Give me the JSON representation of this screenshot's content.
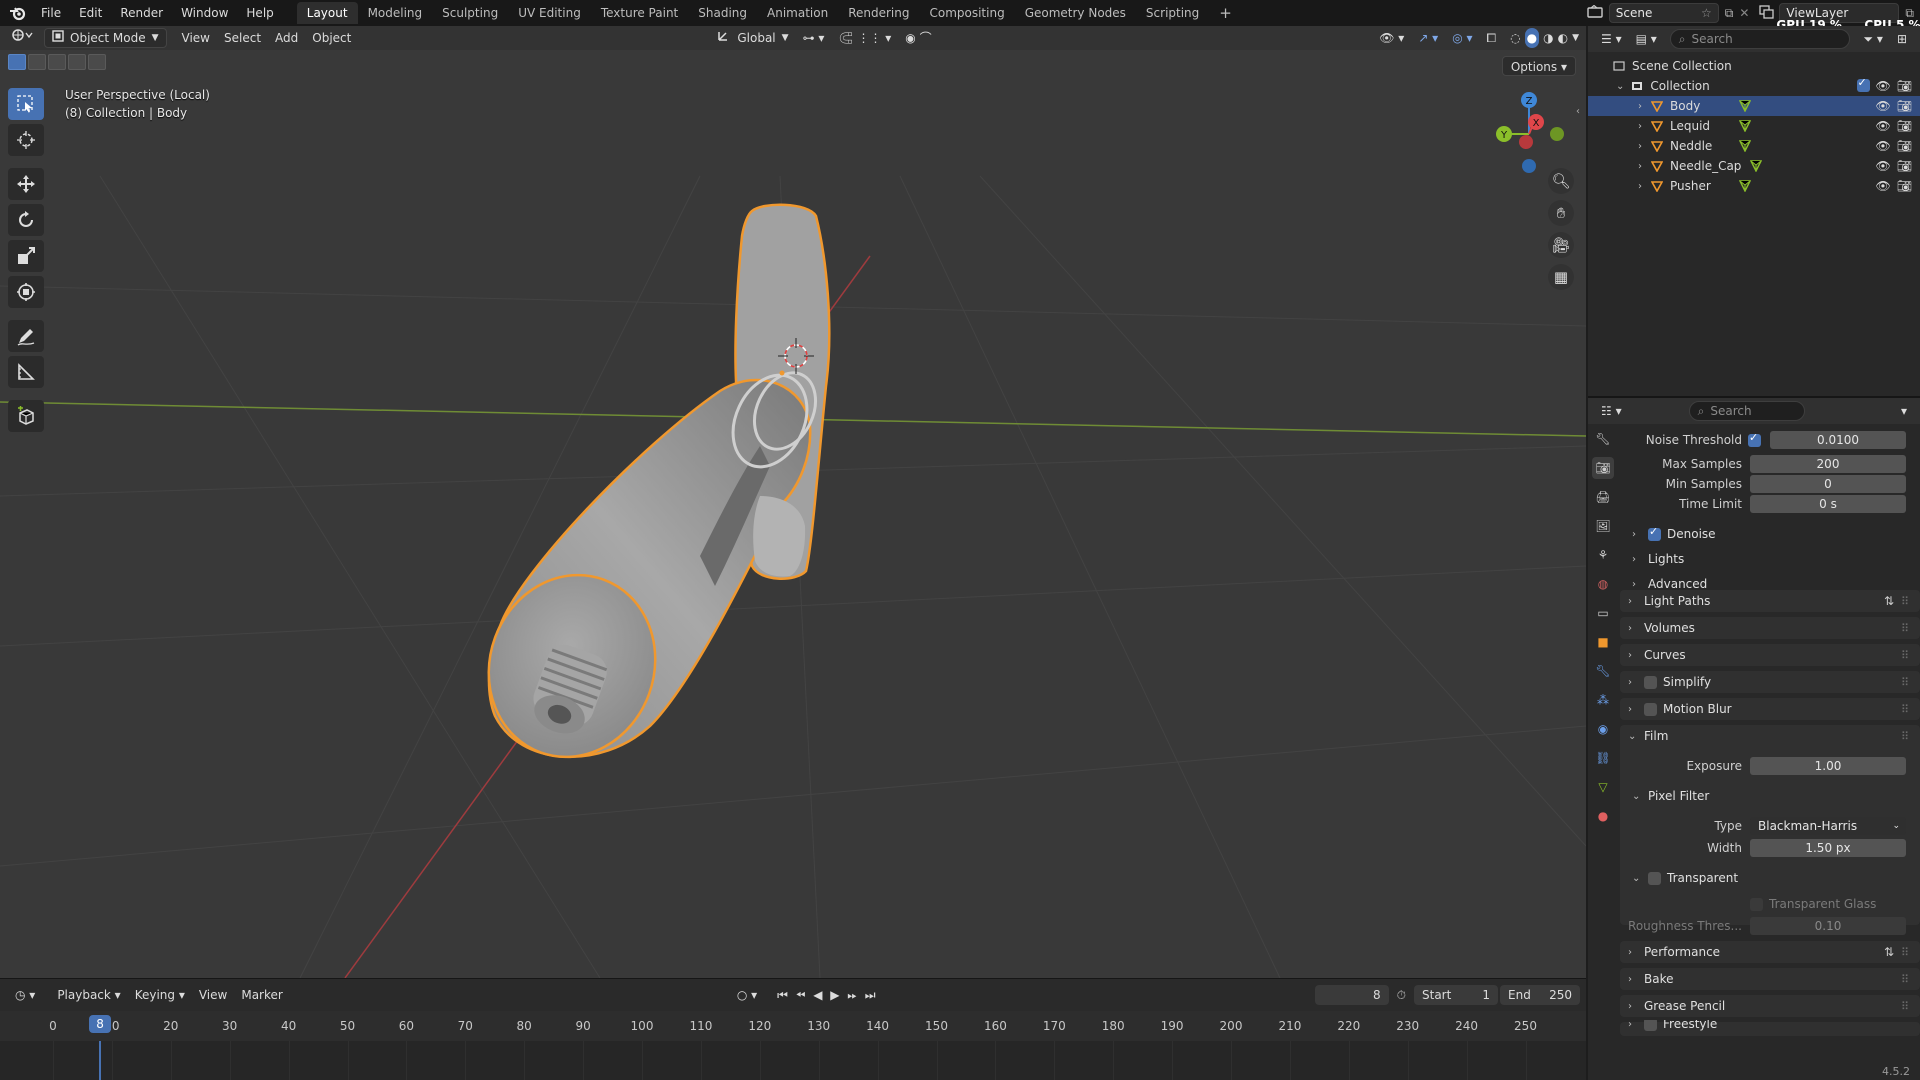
{
  "menubar": {
    "items": [
      "File",
      "Edit",
      "Render",
      "Window",
      "Help"
    ],
    "workspaces": [
      "Layout",
      "Modeling",
      "Sculpting",
      "UV Editing",
      "Texture Paint",
      "Shading",
      "Animation",
      "Rendering",
      "Compositing",
      "Geometry Nodes",
      "Scripting"
    ],
    "active_workspace": "Layout",
    "add_workspace": "+",
    "scene_name": "Scene",
    "view_layer": "ViewLayer",
    "gpu_label": "GPU",
    "gpu_value": "19 %",
    "cpu_label": "CPU",
    "cpu_value": "5 %"
  },
  "viewport": {
    "mode": "Object Mode",
    "menus": [
      "View",
      "Select",
      "Add",
      "Object"
    ],
    "orientation": "Global",
    "options": "Options",
    "info_line1": "User Perspective (Local)",
    "info_line2": "(8) Collection | Body",
    "gizmo_axes": [
      "X",
      "Y",
      "Z"
    ],
    "colors": {
      "x_axis": "#e0464a",
      "y_axis": "#8bbf2a",
      "z_axis": "#3f88d8",
      "selection_outline": "#f0982e",
      "background": "#393939"
    }
  },
  "timeline": {
    "menus": [
      "Playback",
      "Keying",
      "View",
      "Marker"
    ],
    "current_frame": "8",
    "start_label": "Start",
    "start_value": "1",
    "end_label": "End",
    "end_value": "250",
    "ticks": [
      "0",
      "10",
      "20",
      "30",
      "40",
      "50",
      "60",
      "70",
      "80",
      "90",
      "100",
      "110",
      "120",
      "130",
      "140",
      "150",
      "160",
      "170",
      "180",
      "190",
      "200",
      "210",
      "220",
      "230",
      "240",
      "250"
    ]
  },
  "outliner": {
    "search_placeholder": "Search",
    "scene_collection": "Scene Collection",
    "collection": "Collection",
    "objects": [
      {
        "name": "Body",
        "selected": true
      },
      {
        "name": "Lequid",
        "selected": false
      },
      {
        "name": "Neddle",
        "selected": false
      },
      {
        "name": "Needle_Cap",
        "selected": false
      },
      {
        "name": "Pusher",
        "selected": false
      }
    ]
  },
  "properties": {
    "search_placeholder": "Search",
    "noise_threshold_label": "Noise Threshold",
    "noise_threshold_value": "0.0100",
    "max_samples_label": "Max Samples",
    "max_samples_value": "200",
    "min_samples_label": "Min Samples",
    "min_samples_value": "0",
    "time_limit_label": "Time Limit",
    "time_limit_value": "0 s",
    "denoise": "Denoise",
    "lights": "Lights",
    "advanced": "Advanced",
    "light_paths": "Light Paths",
    "volumes": "Volumes",
    "curves": "Curves",
    "simplify": "Simplify",
    "motion_blur": "Motion Blur",
    "film": "Film",
    "exposure_label": "Exposure",
    "exposure_value": "1.00",
    "pixel_filter": "Pixel Filter",
    "type_label": "Type",
    "type_value": "Blackman-Harris",
    "width_label": "Width",
    "width_value": "1.50 px",
    "transparent": "Transparent",
    "transparent_glass": "Transparent Glass",
    "roughness_label": "Roughness Thres...",
    "roughness_value": "0.10",
    "performance": "Performance",
    "bake": "Bake",
    "grease_pencil": "Grease Pencil",
    "freestyle": "Freestyle"
  },
  "status": {
    "version": "4.5.2"
  }
}
